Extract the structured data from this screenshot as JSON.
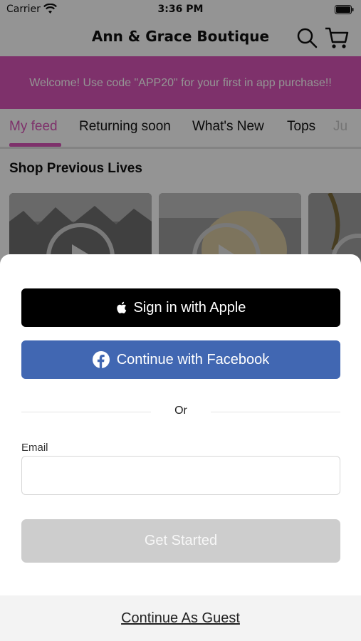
{
  "status_bar": {
    "carrier": "Carrier",
    "time": "3:36 PM"
  },
  "header": {
    "title": "Ann & Grace Boutique"
  },
  "promo": {
    "text": "Welcome! Use code \"APP20\" for your first in app purchase!!",
    "color": "#d955b8"
  },
  "tabs": [
    {
      "label": "My feed",
      "active": true
    },
    {
      "label": "Returning soon"
    },
    {
      "label": "What's New"
    },
    {
      "label": "Tops"
    },
    {
      "label": "Ju"
    }
  ],
  "section": {
    "title": "Shop Previous Lives"
  },
  "login_sheet": {
    "apple_label": "Sign in with Apple",
    "facebook_label": "Continue with Facebook",
    "or_label": "Or",
    "email_label": "Email",
    "email_value": "",
    "get_started_label": "Get Started",
    "guest_label": "Continue As Guest",
    "facebook_color": "#4167b2"
  }
}
